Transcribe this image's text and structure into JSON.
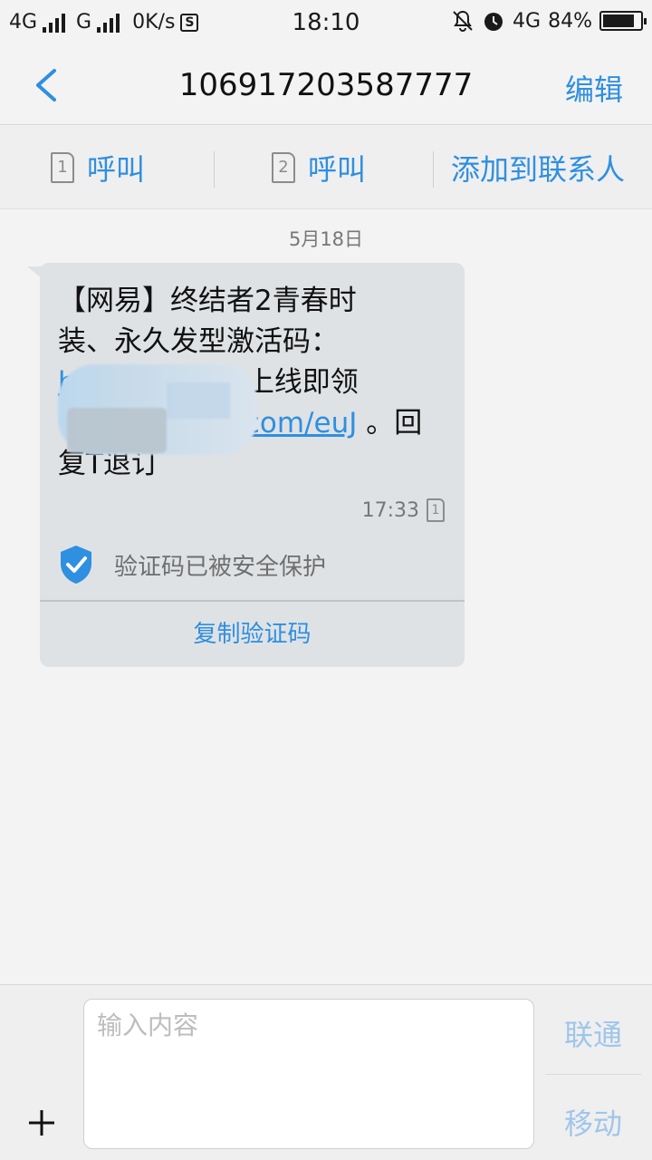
{
  "status_bar": {
    "net1": "4G",
    "net2": "G",
    "speed": "0K/s",
    "s_icon": "S",
    "time": "18:10",
    "net3": "4G",
    "battery": "84%",
    "battery_level": 0.84
  },
  "header": {
    "title": "106917203587777",
    "edit_label": "编辑"
  },
  "actions": {
    "call1_sim": "1",
    "call1_label": "呼叫",
    "call2_sim": "2",
    "call2_label": "呼叫",
    "add_contact_label": "添加到联系人"
  },
  "thread": {
    "date": "5月18日",
    "message": {
      "line1": "【网易】终结者2青春时",
      "line2": "装、永久发型激活码：",
      "line3_link": "ht",
      "line3_text": "上线即领",
      "line4_link": ".com/euJ",
      "line4_text": " 。回",
      "line5": "复T退订",
      "time": "17:33",
      "sim": "1",
      "protect_text": "验证码已被安全保护",
      "copy_label": "复制验证码"
    }
  },
  "composer": {
    "placeholder": "输入内容",
    "send_unicom": "联通",
    "send_mobile": "移动"
  },
  "colors": {
    "accent": "#2f8fe0",
    "bubble": "#dfe2e5",
    "send_disabled": "#9fc6ea"
  }
}
